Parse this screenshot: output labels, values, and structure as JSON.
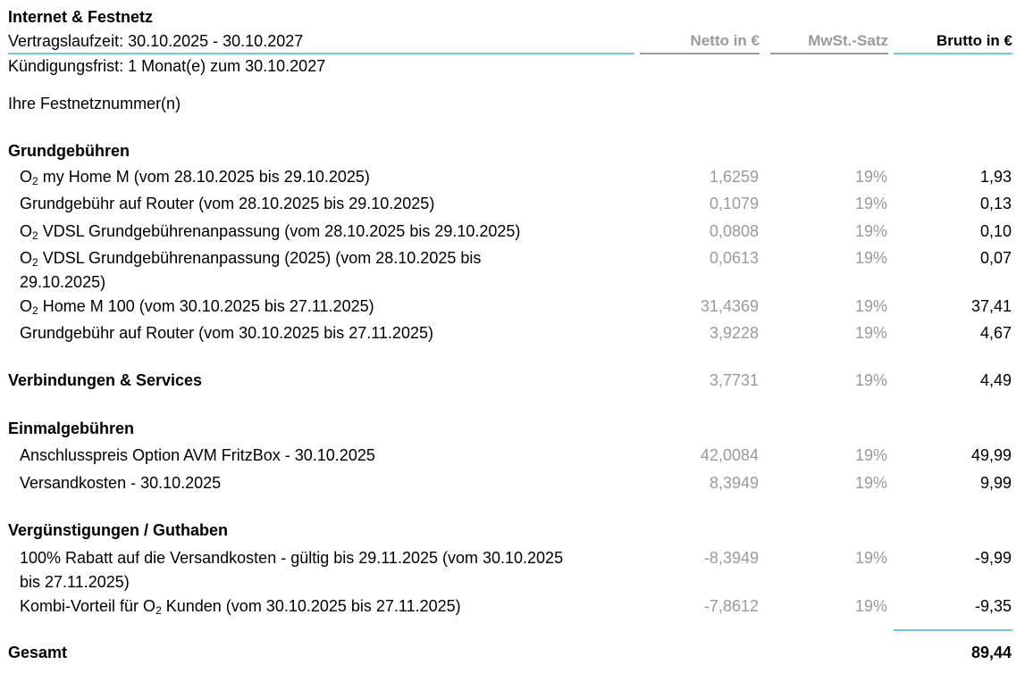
{
  "header": {
    "title": "Internet & Festnetz",
    "contract_term": "Vertragslaufzeit: 30.10.2025 - 30.10.2027",
    "notice": "Kündigungsfrist: 1 Monat(e) zum 30.10.2027",
    "landline": "Ihre Festnetznummer(n)",
    "col_netto": "Netto in €",
    "col_mwst": "MwSt.-Satz",
    "col_brutto": "Brutto in €"
  },
  "colors": {
    "accent_rule": "#6ec9d6",
    "grey_rule": "#9a9a9a",
    "muted_text": "#9a9a9a"
  },
  "sections": {
    "grundgebuehren": {
      "title": "Grundgebühren",
      "items": [
        {
          "pre": "O",
          "sub": "2",
          "desc": " my Home M (vom 28.10.2025 bis 29.10.2025)",
          "netto": "1,6259",
          "mwst": "19%",
          "brutto": "1,93"
        },
        {
          "pre": "",
          "sub": "",
          "desc": "Grundgebühr auf Router (vom 28.10.2025 bis 29.10.2025)",
          "netto": "0,1079",
          "mwst": "19%",
          "brutto": "0,13"
        },
        {
          "pre": "O",
          "sub": "2",
          "desc": " VDSL Grundgebührenanpassung (vom 28.10.2025 bis 29.10.2025)",
          "netto": "0,0808",
          "mwst": "19%",
          "brutto": "0,10"
        },
        {
          "pre": "O",
          "sub": "2",
          "desc": " VDSL Grundgebührenanpassung (2025) (vom 28.10.2025 bis 29.10.2025)",
          "netto": "0,0613",
          "mwst": "19%",
          "brutto": "0,07"
        },
        {
          "pre": "O",
          "sub": "2",
          "desc": " Home M 100 (vom 30.10.2025 bis 27.11.2025)",
          "netto": "31,4369",
          "mwst": "19%",
          "brutto": "37,41"
        },
        {
          "pre": "",
          "sub": "",
          "desc": "Grundgebühr auf Router (vom 30.10.2025 bis 27.11.2025)",
          "netto": "3,9228",
          "mwst": "19%",
          "brutto": "4,67"
        }
      ]
    },
    "verbindungen": {
      "title": "Verbindungen & Services",
      "netto": "3,7731",
      "mwst": "19%",
      "brutto": "4,49"
    },
    "einmal": {
      "title": "Einmalgebühren",
      "items": [
        {
          "desc": "Anschlusspreis Option AVM FritzBox - 30.10.2025",
          "netto": "42,0084",
          "mwst": "19%",
          "brutto": "49,99"
        },
        {
          "desc": "Versandkosten - 30.10.2025",
          "netto": "8,3949",
          "mwst": "19%",
          "brutto": "9,99"
        }
      ]
    },
    "verguenstigungen": {
      "title": "Vergünstigungen / Guthaben",
      "items": [
        {
          "pre": "",
          "sub": "",
          "desc": "100% Rabatt auf die Versandkosten - gültig bis 29.11.2025 (vom 30.10.2025 bis 27.11.2025)",
          "netto": "-8,3949",
          "mwst": "19%",
          "brutto": "-9,99"
        },
        {
          "pre": "Kombi-Vorteil für O",
          "sub": "2",
          "desc": " Kunden (vom 30.10.2025 bis 27.11.2025)",
          "netto": "-7,8612",
          "mwst": "19%",
          "brutto": "-9,35"
        }
      ]
    }
  },
  "total": {
    "label": "Gesamt",
    "value": "89,44"
  }
}
